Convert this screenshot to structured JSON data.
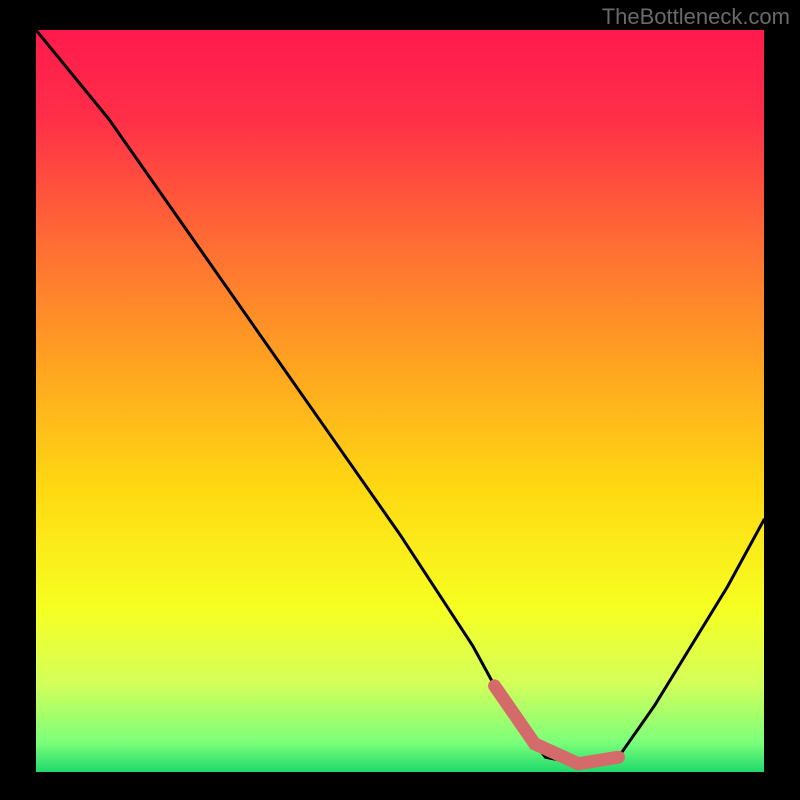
{
  "watermark": "TheBottleneck.com",
  "chart_data": {
    "type": "line",
    "title": "",
    "xlabel": "",
    "ylabel": "",
    "x_range": [
      0,
      100
    ],
    "y_range": [
      0,
      100
    ],
    "series": [
      {
        "name": "bottleneck-curve",
        "x": [
          0,
          10,
          20,
          30,
          40,
          50,
          60,
          65,
          70,
          75,
          80,
          85,
          90,
          95,
          100
        ],
        "y": [
          100,
          88,
          74,
          60,
          46,
          32,
          17,
          8,
          2,
          1,
          2,
          9,
          17,
          25,
          34
        ]
      }
    ],
    "optimal_zone": {
      "x_start": 63,
      "x_end": 80,
      "y_approx": 2
    },
    "background_gradient": {
      "stops": [
        {
          "pos": 0.0,
          "color": "#ff1a4d"
        },
        {
          "pos": 0.12,
          "color": "#ff2f48"
        },
        {
          "pos": 0.28,
          "color": "#ff6a35"
        },
        {
          "pos": 0.45,
          "color": "#ffa321"
        },
        {
          "pos": 0.62,
          "color": "#ffd912"
        },
        {
          "pos": 0.78,
          "color": "#f6ff22"
        },
        {
          "pos": 0.88,
          "color": "#d4ff5a"
        },
        {
          "pos": 0.96,
          "color": "#7cff7a"
        },
        {
          "pos": 1.0,
          "color": "#1fd96b"
        }
      ]
    },
    "colors": {
      "curve": "#000000",
      "highlight": "#d56a6a",
      "frame": "#000000"
    }
  }
}
